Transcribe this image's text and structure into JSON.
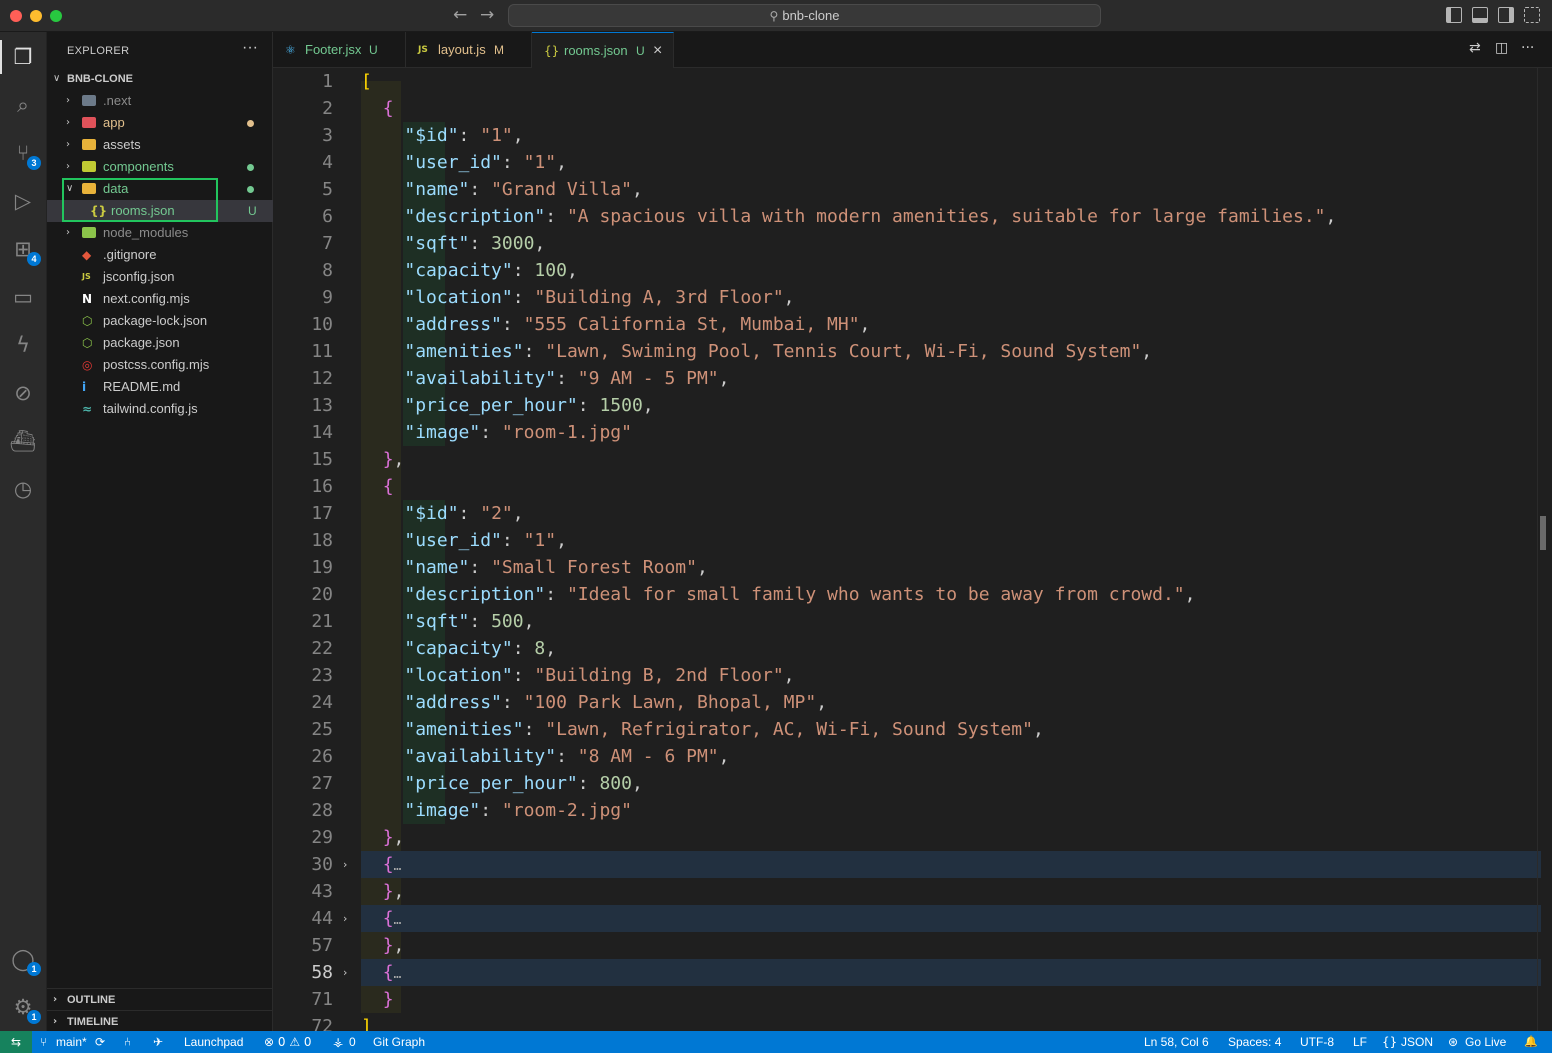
{
  "window": {
    "title": "bnb-clone"
  },
  "sidebar": {
    "title": "EXPLORER",
    "more": "···",
    "root": "BNB-CLONE",
    "items": [
      {
        "label": ".next",
        "type": "folder",
        "color": "#6c7a89",
        "label_color": "#8b8b8b"
      },
      {
        "label": "app",
        "type": "folder",
        "color": "#e0525a",
        "label_color": "#e2c08d",
        "dot_color": "#e2c08d"
      },
      {
        "label": "assets",
        "type": "folder",
        "color": "#e8b23a",
        "label_color": "#cccccc"
      },
      {
        "label": "components",
        "type": "folder",
        "color": "#c0ca33",
        "label_color": "#73c991",
        "dot_color": "#73c991"
      },
      {
        "label": "data",
        "type": "folder-open",
        "color": "#e8b23a",
        "label_color": "#73c991",
        "dot_color": "#73c991"
      },
      {
        "label": "rooms.json",
        "type": "json",
        "icon": "{}",
        "label_color": "#73c991",
        "status": "U"
      },
      {
        "label": "node_modules",
        "type": "folder",
        "color": "#8bc34a",
        "label_color": "#8b8b8b"
      },
      {
        "label": ".gitignore",
        "type": "file",
        "icon": "◆",
        "icon_color": "#e4573c",
        "label_color": "#cccccc"
      },
      {
        "label": "jsconfig.json",
        "type": "file",
        "icon": "JS",
        "icon_color": "#cbcb41",
        "label_color": "#cccccc"
      },
      {
        "label": "next.config.mjs",
        "type": "file",
        "icon": "N",
        "icon_color": "#ffffff",
        "label_color": "#cccccc"
      },
      {
        "label": "package-lock.json",
        "type": "file",
        "icon": "⬡",
        "icon_color": "#8bc34a",
        "label_color": "#cccccc"
      },
      {
        "label": "package.json",
        "type": "file",
        "icon": "⬡",
        "icon_color": "#8bc34a",
        "label_color": "#cccccc"
      },
      {
        "label": "postcss.config.mjs",
        "type": "file",
        "icon": "◎",
        "icon_color": "#e53935",
        "label_color": "#cccccc"
      },
      {
        "label": "README.md",
        "type": "file",
        "icon": "i",
        "icon_color": "#42a5f5",
        "label_color": "#cccccc"
      },
      {
        "label": "tailwind.config.js",
        "type": "file",
        "icon": "≈",
        "icon_color": "#4db6ac",
        "label_color": "#cccccc"
      }
    ],
    "outline": "OUTLINE",
    "timeline": "TIMELINE"
  },
  "activity": {
    "scm_badge": "3",
    "ext_badge": "4",
    "account_badge": "1",
    "settings_badge": "1"
  },
  "tabs": [
    {
      "label": "Footer.jsx",
      "status": "U",
      "icon": "⚛",
      "icon_color": "#4fc1ff",
      "label_color": "#73c991",
      "status_color": "#73c991"
    },
    {
      "label": "layout.js",
      "status": "M",
      "icon": "JS",
      "icon_color": "#cbcb41",
      "label_color": "#e2c08d",
      "status_color": "#e2c08d"
    },
    {
      "label": "rooms.json",
      "status": "U",
      "icon": "{}",
      "icon_color": "#cbcb41",
      "label_color": "#73c991",
      "status_color": "#73c991",
      "close": "×"
    }
  ],
  "editor": {
    "lines": [
      {
        "n": "1",
        "t": "["
      },
      {
        "n": "2",
        "t": "  {"
      },
      {
        "n": "3",
        "t": "    \"$id\": \"1\","
      },
      {
        "n": "4",
        "t": "    \"user_id\": \"1\","
      },
      {
        "n": "5",
        "t": "    \"name\": \"Grand Villa\","
      },
      {
        "n": "6",
        "t": "    \"description\": \"A spacious villa with modern amenities, suitable for large families.\","
      },
      {
        "n": "7",
        "t": "    \"sqft\": 3000,"
      },
      {
        "n": "8",
        "t": "    \"capacity\": 100,"
      },
      {
        "n": "9",
        "t": "    \"location\": \"Building A, 3rd Floor\","
      },
      {
        "n": "10",
        "t": "    \"address\": \"555 California St, Mumbai, MH\","
      },
      {
        "n": "11",
        "t": "    \"amenities\": \"Lawn, Swiming Pool, Tennis Court, Wi-Fi, Sound System\","
      },
      {
        "n": "12",
        "t": "    \"availability\": \"9 AM - 5 PM\","
      },
      {
        "n": "13",
        "t": "    \"price_per_hour\": 1500,"
      },
      {
        "n": "14",
        "t": "    \"image\": \"room-1.jpg\""
      },
      {
        "n": "15",
        "t": "  },"
      },
      {
        "n": "16",
        "t": "  {"
      },
      {
        "n": "17",
        "t": "    \"$id\": \"2\","
      },
      {
        "n": "18",
        "t": "    \"user_id\": \"1\","
      },
      {
        "n": "19",
        "t": "    \"name\": \"Small Forest Room\","
      },
      {
        "n": "20",
        "t": "    \"description\": \"Ideal for small family who wants to be away from crowd.\","
      },
      {
        "n": "21",
        "t": "    \"sqft\": 500,"
      },
      {
        "n": "22",
        "t": "    \"capacity\": 8,"
      },
      {
        "n": "23",
        "t": "    \"location\": \"Building B, 2nd Floor\","
      },
      {
        "n": "24",
        "t": "    \"address\": \"100 Park Lawn, Bhopal, MP\","
      },
      {
        "n": "25",
        "t": "    \"amenities\": \"Lawn, Refrigirator, AC, Wi-Fi, Sound System\","
      },
      {
        "n": "26",
        "t": "    \"availability\": \"8 AM - 6 PM\","
      },
      {
        "n": "27",
        "t": "    \"price_per_hour\": 800,"
      },
      {
        "n": "28",
        "t": "    \"image\": \"room-2.jpg\""
      },
      {
        "n": "29",
        "t": "  },"
      },
      {
        "n": "30",
        "t": "  {…",
        "folded": true
      },
      {
        "n": "43",
        "t": "  },"
      },
      {
        "n": "44",
        "t": "  {…",
        "folded": true
      },
      {
        "n": "57",
        "t": "  },"
      },
      {
        "n": "58",
        "t": "  {…",
        "folded": true,
        "current": true
      },
      {
        "n": "71",
        "t": "  }"
      },
      {
        "n": "72",
        "t": "]"
      }
    ]
  },
  "status": {
    "remote": "⇆",
    "branch": "main*",
    "sync": "⟳",
    "launchpad": "Launchpad",
    "problems": "⊗ 0 ⚠ 0",
    "ports": "0",
    "git_graph": "Git Graph",
    "position": "Ln 58, Col 6",
    "spaces": "Spaces: 4",
    "encoding": "UTF-8",
    "eol": "LF",
    "language": "JSON",
    "golive": "Go Live",
    "bell": "🔔"
  }
}
